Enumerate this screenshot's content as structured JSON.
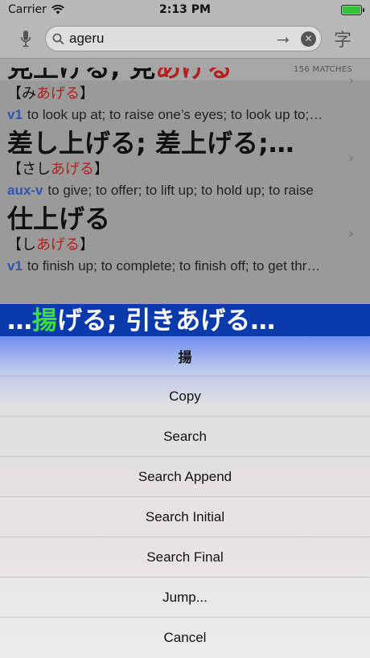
{
  "status": {
    "carrier": "Carrier",
    "time": "2:13 PM"
  },
  "search": {
    "value": "ageru",
    "arrow": "⭢",
    "clear": "✕",
    "kanji_button": "字"
  },
  "matches": "156 MATCHES",
  "partial_top": {
    "pre": "見上げる; 見",
    "hl": "あげる"
  },
  "entries": [
    {
      "reading_pre": "【み",
      "reading_hl": "あげる",
      "reading_post": "】",
      "pos": "v1",
      "gloss": "to look up at; to raise one’s eyes; to look up to;…"
    },
    {
      "headword": "差し上げる; 差上げる;…",
      "reading_pre": "【さし",
      "reading_hl": "あげる",
      "reading_post": "】",
      "pos": "aux-v",
      "gloss": "to give; to offer; to lift up; to hold up; to raise"
    },
    {
      "headword": "仕上げる",
      "reading_pre": "【し",
      "reading_hl": "あげる",
      "reading_post": "】",
      "pos": "v1",
      "gloss": "to finish up; to complete; to finish off; to get thr…"
    }
  ],
  "selected": {
    "prefix": "…",
    "green": "揚",
    "rest": "げる; 引きあげる…"
  },
  "sheet": {
    "title": "揚",
    "items": [
      "Copy",
      "Search",
      "Search Append",
      "Search Initial",
      "Search Final",
      "Jump...",
      "Cancel"
    ]
  }
}
